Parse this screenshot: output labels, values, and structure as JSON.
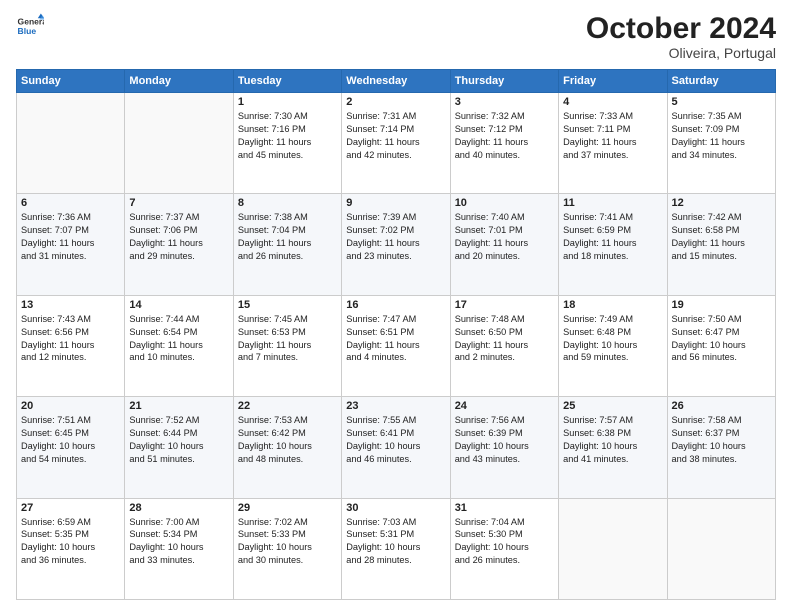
{
  "header": {
    "logo_line1": "General",
    "logo_line2": "Blue",
    "month": "October 2024",
    "location": "Oliveira, Portugal"
  },
  "weekdays": [
    "Sunday",
    "Monday",
    "Tuesday",
    "Wednesday",
    "Thursday",
    "Friday",
    "Saturday"
  ],
  "rows": [
    [
      {
        "day": "",
        "lines": []
      },
      {
        "day": "",
        "lines": []
      },
      {
        "day": "1",
        "lines": [
          "Sunrise: 7:30 AM",
          "Sunset: 7:16 PM",
          "Daylight: 11 hours",
          "and 45 minutes."
        ]
      },
      {
        "day": "2",
        "lines": [
          "Sunrise: 7:31 AM",
          "Sunset: 7:14 PM",
          "Daylight: 11 hours",
          "and 42 minutes."
        ]
      },
      {
        "day": "3",
        "lines": [
          "Sunrise: 7:32 AM",
          "Sunset: 7:12 PM",
          "Daylight: 11 hours",
          "and 40 minutes."
        ]
      },
      {
        "day": "4",
        "lines": [
          "Sunrise: 7:33 AM",
          "Sunset: 7:11 PM",
          "Daylight: 11 hours",
          "and 37 minutes."
        ]
      },
      {
        "day": "5",
        "lines": [
          "Sunrise: 7:35 AM",
          "Sunset: 7:09 PM",
          "Daylight: 11 hours",
          "and 34 minutes."
        ]
      }
    ],
    [
      {
        "day": "6",
        "lines": [
          "Sunrise: 7:36 AM",
          "Sunset: 7:07 PM",
          "Daylight: 11 hours",
          "and 31 minutes."
        ]
      },
      {
        "day": "7",
        "lines": [
          "Sunrise: 7:37 AM",
          "Sunset: 7:06 PM",
          "Daylight: 11 hours",
          "and 29 minutes."
        ]
      },
      {
        "day": "8",
        "lines": [
          "Sunrise: 7:38 AM",
          "Sunset: 7:04 PM",
          "Daylight: 11 hours",
          "and 26 minutes."
        ]
      },
      {
        "day": "9",
        "lines": [
          "Sunrise: 7:39 AM",
          "Sunset: 7:02 PM",
          "Daylight: 11 hours",
          "and 23 minutes."
        ]
      },
      {
        "day": "10",
        "lines": [
          "Sunrise: 7:40 AM",
          "Sunset: 7:01 PM",
          "Daylight: 11 hours",
          "and 20 minutes."
        ]
      },
      {
        "day": "11",
        "lines": [
          "Sunrise: 7:41 AM",
          "Sunset: 6:59 PM",
          "Daylight: 11 hours",
          "and 18 minutes."
        ]
      },
      {
        "day": "12",
        "lines": [
          "Sunrise: 7:42 AM",
          "Sunset: 6:58 PM",
          "Daylight: 11 hours",
          "and 15 minutes."
        ]
      }
    ],
    [
      {
        "day": "13",
        "lines": [
          "Sunrise: 7:43 AM",
          "Sunset: 6:56 PM",
          "Daylight: 11 hours",
          "and 12 minutes."
        ]
      },
      {
        "day": "14",
        "lines": [
          "Sunrise: 7:44 AM",
          "Sunset: 6:54 PM",
          "Daylight: 11 hours",
          "and 10 minutes."
        ]
      },
      {
        "day": "15",
        "lines": [
          "Sunrise: 7:45 AM",
          "Sunset: 6:53 PM",
          "Daylight: 11 hours",
          "and 7 minutes."
        ]
      },
      {
        "day": "16",
        "lines": [
          "Sunrise: 7:47 AM",
          "Sunset: 6:51 PM",
          "Daylight: 11 hours",
          "and 4 minutes."
        ]
      },
      {
        "day": "17",
        "lines": [
          "Sunrise: 7:48 AM",
          "Sunset: 6:50 PM",
          "Daylight: 11 hours",
          "and 2 minutes."
        ]
      },
      {
        "day": "18",
        "lines": [
          "Sunrise: 7:49 AM",
          "Sunset: 6:48 PM",
          "Daylight: 10 hours",
          "and 59 minutes."
        ]
      },
      {
        "day": "19",
        "lines": [
          "Sunrise: 7:50 AM",
          "Sunset: 6:47 PM",
          "Daylight: 10 hours",
          "and 56 minutes."
        ]
      }
    ],
    [
      {
        "day": "20",
        "lines": [
          "Sunrise: 7:51 AM",
          "Sunset: 6:45 PM",
          "Daylight: 10 hours",
          "and 54 minutes."
        ]
      },
      {
        "day": "21",
        "lines": [
          "Sunrise: 7:52 AM",
          "Sunset: 6:44 PM",
          "Daylight: 10 hours",
          "and 51 minutes."
        ]
      },
      {
        "day": "22",
        "lines": [
          "Sunrise: 7:53 AM",
          "Sunset: 6:42 PM",
          "Daylight: 10 hours",
          "and 48 minutes."
        ]
      },
      {
        "day": "23",
        "lines": [
          "Sunrise: 7:55 AM",
          "Sunset: 6:41 PM",
          "Daylight: 10 hours",
          "and 46 minutes."
        ]
      },
      {
        "day": "24",
        "lines": [
          "Sunrise: 7:56 AM",
          "Sunset: 6:39 PM",
          "Daylight: 10 hours",
          "and 43 minutes."
        ]
      },
      {
        "day": "25",
        "lines": [
          "Sunrise: 7:57 AM",
          "Sunset: 6:38 PM",
          "Daylight: 10 hours",
          "and 41 minutes."
        ]
      },
      {
        "day": "26",
        "lines": [
          "Sunrise: 7:58 AM",
          "Sunset: 6:37 PM",
          "Daylight: 10 hours",
          "and 38 minutes."
        ]
      }
    ],
    [
      {
        "day": "27",
        "lines": [
          "Sunrise: 6:59 AM",
          "Sunset: 5:35 PM",
          "Daylight: 10 hours",
          "and 36 minutes."
        ]
      },
      {
        "day": "28",
        "lines": [
          "Sunrise: 7:00 AM",
          "Sunset: 5:34 PM",
          "Daylight: 10 hours",
          "and 33 minutes."
        ]
      },
      {
        "day": "29",
        "lines": [
          "Sunrise: 7:02 AM",
          "Sunset: 5:33 PM",
          "Daylight: 10 hours",
          "and 30 minutes."
        ]
      },
      {
        "day": "30",
        "lines": [
          "Sunrise: 7:03 AM",
          "Sunset: 5:31 PM",
          "Daylight: 10 hours",
          "and 28 minutes."
        ]
      },
      {
        "day": "31",
        "lines": [
          "Sunrise: 7:04 AM",
          "Sunset: 5:30 PM",
          "Daylight: 10 hours",
          "and 26 minutes."
        ]
      },
      {
        "day": "",
        "lines": []
      },
      {
        "day": "",
        "lines": []
      }
    ]
  ]
}
